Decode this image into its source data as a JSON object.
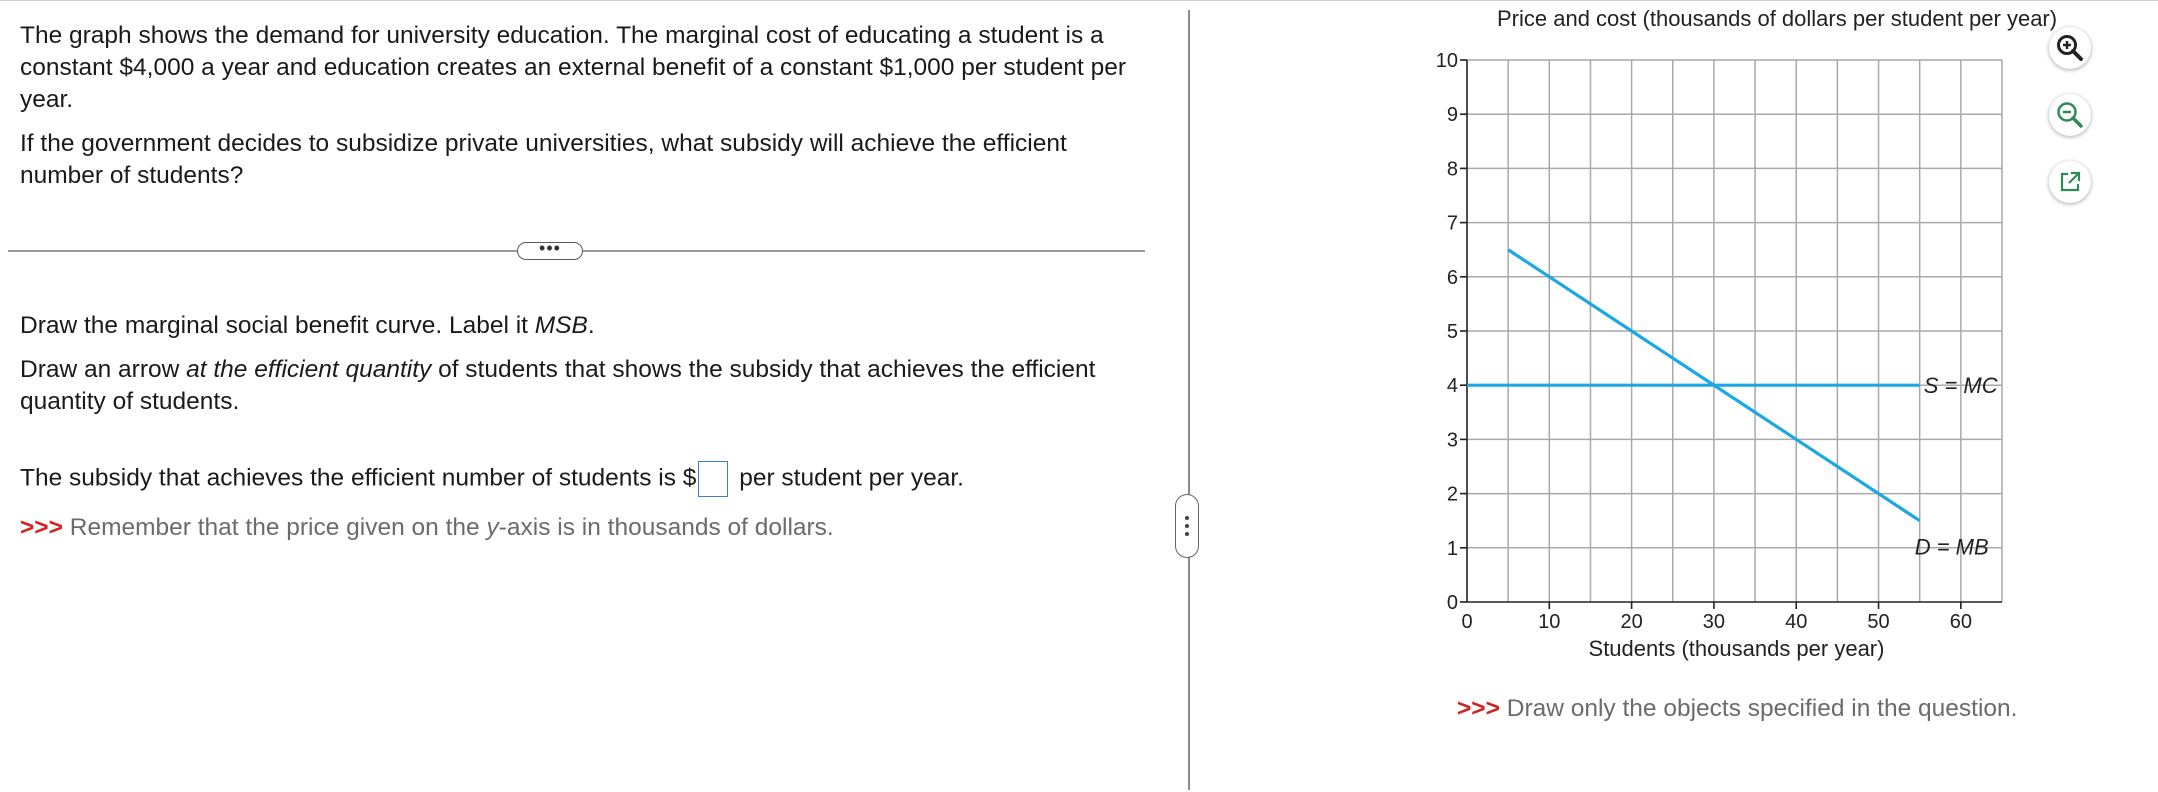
{
  "question": {
    "intro": "The graph shows the demand for university education. The marginal cost of educating a student is a constant $4,000 a year and education creates an external benefit of a constant $1,000 per student per year.",
    "prompt": "If the government decides to subsidize private universities, what subsidy will achieve the efficient number of students?",
    "more_label": "•••",
    "instruction1_pre": "Draw the marginal social benefit curve. Label it ",
    "instruction1_em": "MSB",
    "instruction1_post": ".",
    "instruction2_pre": "Draw an arrow ",
    "instruction2_em": "at the efficient quantity",
    "instruction2_post": " of students that shows the subsidy that achieves the efficient quantity of students.",
    "answer_pre": "The subsidy that achieves the efficient number of students is $",
    "answer_value": "",
    "answer_post": " per student per year.",
    "hint_arrows": ">>>",
    "hint_pre": " Remember that the price given on the ",
    "hint_em": "y",
    "hint_post": "-axis is in thousands of dollars."
  },
  "graph_panel": {
    "hint_arrows": ">>>",
    "hint": " Draw only the objects specified in the question.",
    "tools": {
      "zoom_in": "zoom-in-icon",
      "zoom_out": "zoom-out-icon",
      "popout": "external-link-icon"
    },
    "curve_color": "#1aa7e3"
  },
  "chart_data": {
    "type": "line",
    "title": "",
    "ylabel": "Price and cost (thousands of dollars per student per year)",
    "xlabel": "Students (thousands per year)",
    "xlim": [
      0,
      65
    ],
    "ylim": [
      0,
      10
    ],
    "x_ticks": [
      0,
      10,
      20,
      30,
      40,
      50,
      60
    ],
    "y_ticks": [
      0,
      1,
      2,
      3,
      4,
      5,
      6,
      7,
      8,
      9,
      10
    ],
    "grid": true,
    "series": [
      {
        "name": "S = MC",
        "points": [
          [
            0,
            4
          ],
          [
            55,
            4
          ]
        ]
      },
      {
        "name": "D = MB",
        "points": [
          [
            5,
            6.5
          ],
          [
            55,
            1.5
          ]
        ]
      }
    ]
  }
}
